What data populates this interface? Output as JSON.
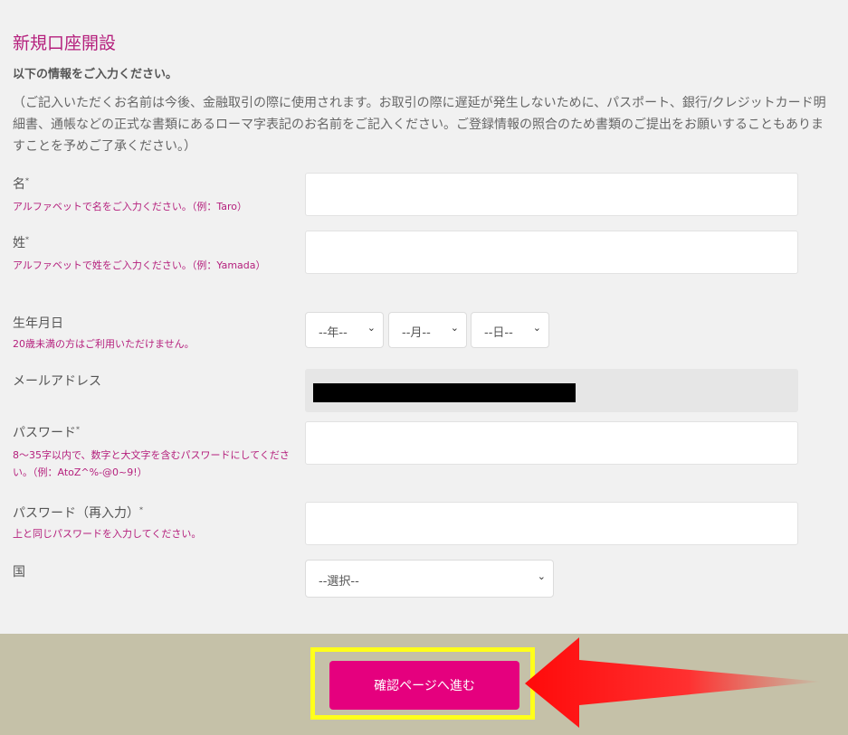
{
  "title": "新規口座開設",
  "subtitle": "以下の情報をご入力ください。",
  "intro": "（ご記入いただくお名前は今後、金融取引の際に使用されます。お取引の際に遅延が発生しないために、パスポート、銀行/クレジットカード明細書、通帳などの正式な書類にあるローマ字表記のお名前をご記入ください。ご登録情報の照合のため書類のご提出をお願いすることもありますことを予めご了承ください。）",
  "fields": {
    "first_name": {
      "label": "名",
      "hint": "アルファベットで名をご入力ください。（例：Taro）"
    },
    "last_name": {
      "label": "姓",
      "hint": "アルファベットで姓をご入力ください。（例：Yamada）"
    },
    "birthdate": {
      "label": "生年月日",
      "hint": "20歳未満の方はご利用いただけません。",
      "year": "--年--",
      "month": "--月--",
      "day": "--日--"
    },
    "email": {
      "label": "メールアドレス"
    },
    "password": {
      "label": "パスワード",
      "hint": "8〜35字以内で、数字と大文字を含むパスワードにしてください。（例：AtoZ^%-@0~9!）"
    },
    "password_confirm": {
      "label": "パスワード（再入力）",
      "hint": "上と同じパスワードを入力してください。"
    },
    "country": {
      "label": "国",
      "selected": "--選択--"
    }
  },
  "required_mark": "*",
  "submit_label": "確認ページへ進む",
  "colors": {
    "accent": "#b5207d",
    "button": "#e5007e",
    "footer": "#c5c1a8",
    "highlight": "#ffff1a",
    "arrow": "#ff1a1a"
  },
  "icons": {
    "select_chevron": "chevron-down-icon",
    "annotation": "red-arrow-icon"
  }
}
